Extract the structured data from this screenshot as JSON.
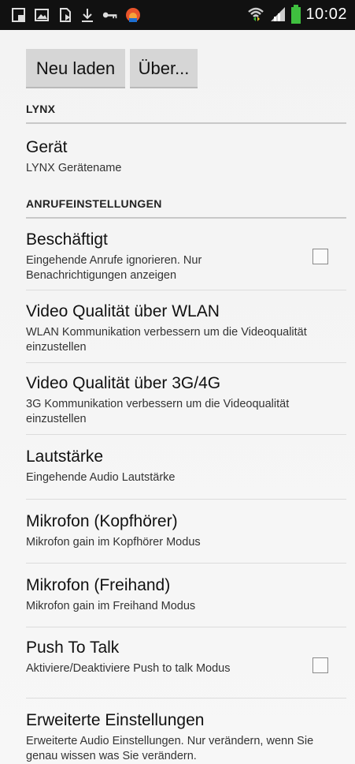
{
  "statusbar": {
    "time": "10:02",
    "icons": [
      "screenshot-icon",
      "image-icon",
      "sd-card-icon",
      "download-icon",
      "key-icon",
      "app-icon",
      "wifi-icon",
      "signal-icon",
      "battery-icon"
    ],
    "battery_color": "#3fbf3f"
  },
  "buttons": {
    "reload_label": "Neu laden",
    "about_label": "Über..."
  },
  "sections": {
    "lynx": "LYNX",
    "calls": "ANRUFEINSTELLUNGEN"
  },
  "prefs": {
    "device": {
      "title": "Gerät",
      "summary": "LYNX Gerätename"
    },
    "busy": {
      "title": "Beschäftigt",
      "summary": "Eingehende Anrufe ignorieren. Nur Benachrichtigungen anzeigen",
      "checked": false
    },
    "video_wlan": {
      "title": "Video Qualität über WLAN",
      "summary": "WLAN Kommunikation verbessern um die Videoqualität einzustellen"
    },
    "video_mobile": {
      "title": "Video Qualität über 3G/4G",
      "summary": "3G Kommunikation verbessern um die Videoqualität einzustellen"
    },
    "volume": {
      "title": "Lautstärke",
      "summary": "Eingehende Audio Lautstärke"
    },
    "mic_headset": {
      "title": "Mikrofon (Kopfhörer)",
      "summary": "Mikrofon gain im Kopfhörer Modus"
    },
    "mic_handsfree": {
      "title": "Mikrofon (Freihand)",
      "summary": "Mikrofon gain im Freihand Modus"
    },
    "ptt": {
      "title": "Push To Talk",
      "summary": "Aktiviere/Deaktiviere Push to talk Modus",
      "checked": false
    },
    "advanced": {
      "title": "Erweiterte Einstellungen",
      "summary": "Erweiterte Audio Einstellungen. Nur verändern, wenn Sie genau wissen was Sie verändern."
    }
  }
}
